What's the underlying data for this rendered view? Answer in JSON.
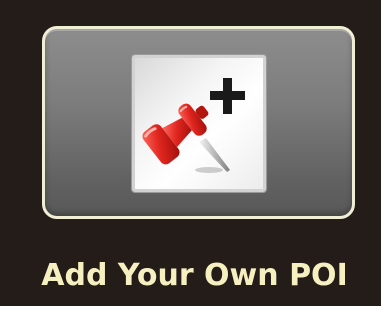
{
  "poi_button": {
    "label": "Add Your Own POI",
    "icon": "pushpin-add-icon"
  },
  "colors": {
    "panel_background": "#241c18",
    "button_border": "#f1eed6",
    "label_text": "#f6efbf",
    "pin_red": "#d8231f",
    "plus_black": "#1a1a1a"
  }
}
